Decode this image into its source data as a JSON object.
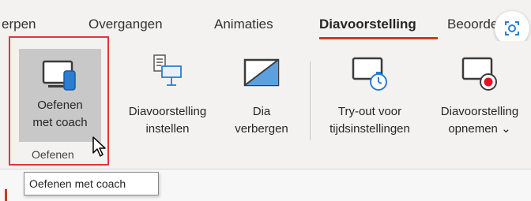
{
  "tabs": [
    {
      "label": "erpen"
    },
    {
      "label": "Overgangen"
    },
    {
      "label": "Animaties"
    },
    {
      "label": "Diavoorstelling",
      "active": true
    },
    {
      "label": "Beoordelen"
    }
  ],
  "ribbon": {
    "practice_button": {
      "line1": "Oefenen",
      "line2": "met coach",
      "icon": "presenter-coach-icon"
    },
    "setup_button": {
      "line1": "Diavoorstelling",
      "line2": "instellen",
      "icon": "slideshow-setup-icon"
    },
    "hide_button": {
      "line1": "Dia",
      "line2": "verbergen",
      "icon": "hide-slide-icon"
    },
    "rehearse_button": {
      "line1": "Try-out voor",
      "line2": "tijdsinstellingen",
      "icon": "rehearse-timings-icon"
    },
    "record_button": {
      "line1": "Diavoorstelling",
      "line2": "opnemen",
      "dropdown_glyph": "⌄",
      "icon": "record-icon"
    },
    "group_label": "Oefenen"
  },
  "tooltip": {
    "text": "Oefenen met coach"
  },
  "colors": {
    "accent": "#c43e1c",
    "highlight_box": "#e5333b",
    "icon_blue": "#2b7cd3",
    "record_red": "#e81123"
  }
}
